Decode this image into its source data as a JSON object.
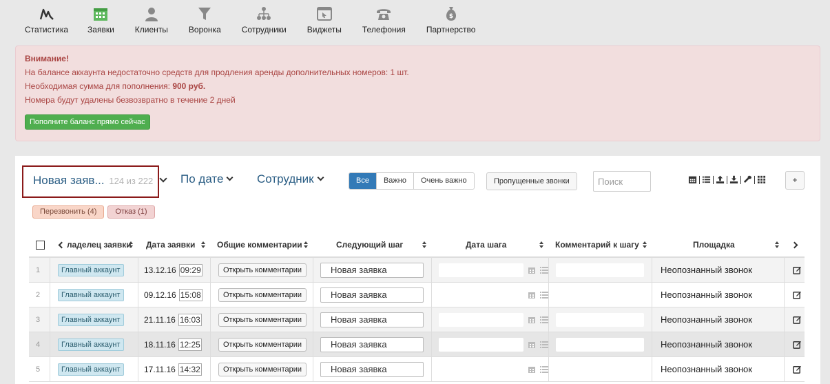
{
  "nav": {
    "items": [
      {
        "label": "Статистика",
        "icon": "chart-line-icon",
        "color": "#333333"
      },
      {
        "label": "Заявки",
        "icon": "calendar-icon",
        "color": "#5cb85c"
      },
      {
        "label": "Клиенты",
        "icon": "user-icon",
        "color": "#888888"
      },
      {
        "label": "Воронка",
        "icon": "filter-icon",
        "color": "#888888"
      },
      {
        "label": "Сотрудники",
        "icon": "org-chart-icon",
        "color": "#888888"
      },
      {
        "label": "Виджеты",
        "icon": "widget-window-icon",
        "color": "#888888"
      },
      {
        "label": "Телефония",
        "icon": "telephone-icon",
        "color": "#888888"
      },
      {
        "label": "Партнерство",
        "icon": "money-bag-icon",
        "color": "#888888"
      }
    ]
  },
  "alert": {
    "title": "Внимание!",
    "line1": "На балансе аккаунта недостаточно средств для продления аренды дополнительных номеров: 1 шт.",
    "line2_prefix": "Необходимая сумма для пополнения: ",
    "line2_amount": "900 руб.",
    "line3": "Номера будут удалены безвозвратно в течение 2 дней",
    "button": "Пополните баланс прямо сейчас"
  },
  "toolbar": {
    "filter_title": "Новая заяв...",
    "filter_count": "124 из 222",
    "by_date": "По дате",
    "employee": "Сотрудник",
    "seg_all": "Все",
    "seg_important": "Важно",
    "seg_very_important": "Очень важно",
    "missed_calls": "Пропущенные звонки",
    "search_placeholder": "Поиск",
    "plus": "+"
  },
  "tags": {
    "callback": "Перезвонить (4)",
    "refusal": "Отказ (1)"
  },
  "table": {
    "headers": {
      "owner": "ладелец заявки",
      "date": "Дата заявки",
      "comments": "Общие комментарии",
      "next_step": "Следующий шаг",
      "step_date": "Дата шага",
      "step_comment": "Комментарий к шагу",
      "source": "Площадка"
    },
    "rows": [
      {
        "num": "1",
        "owner": "Главный аккаунт",
        "date": "13.12.16",
        "time": "09:29",
        "comments_btn": "Открыть комментарии",
        "next_step": "Новая заявка",
        "source": "Неопознанный звонок"
      },
      {
        "num": "2",
        "owner": "Главный аккаунт",
        "date": "09.12.16",
        "time": "15:08",
        "comments_btn": "Открыть комментарии",
        "next_step": "Новая заявка",
        "source": "Неопознанный звонок"
      },
      {
        "num": "3",
        "owner": "Главный аккаунт",
        "date": "21.11.16",
        "time": "16:03",
        "comments_btn": "Открыть комментарии",
        "next_step": "Новая заявка",
        "source": "Неопознанный звонок"
      },
      {
        "num": "4",
        "owner": "Главный аккаунт",
        "date": "18.11.16",
        "time": "12:25",
        "comments_btn": "Открыть комментарии",
        "next_step": "Новая заявка",
        "source": "Неопознанный звонок"
      },
      {
        "num": "5",
        "owner": "Главный аккаунт",
        "date": "17.11.16",
        "time": "14:32",
        "comments_btn": "Открыть комментарии",
        "next_step": "Новая заявка",
        "source": "Неопознанный звонок"
      }
    ]
  }
}
